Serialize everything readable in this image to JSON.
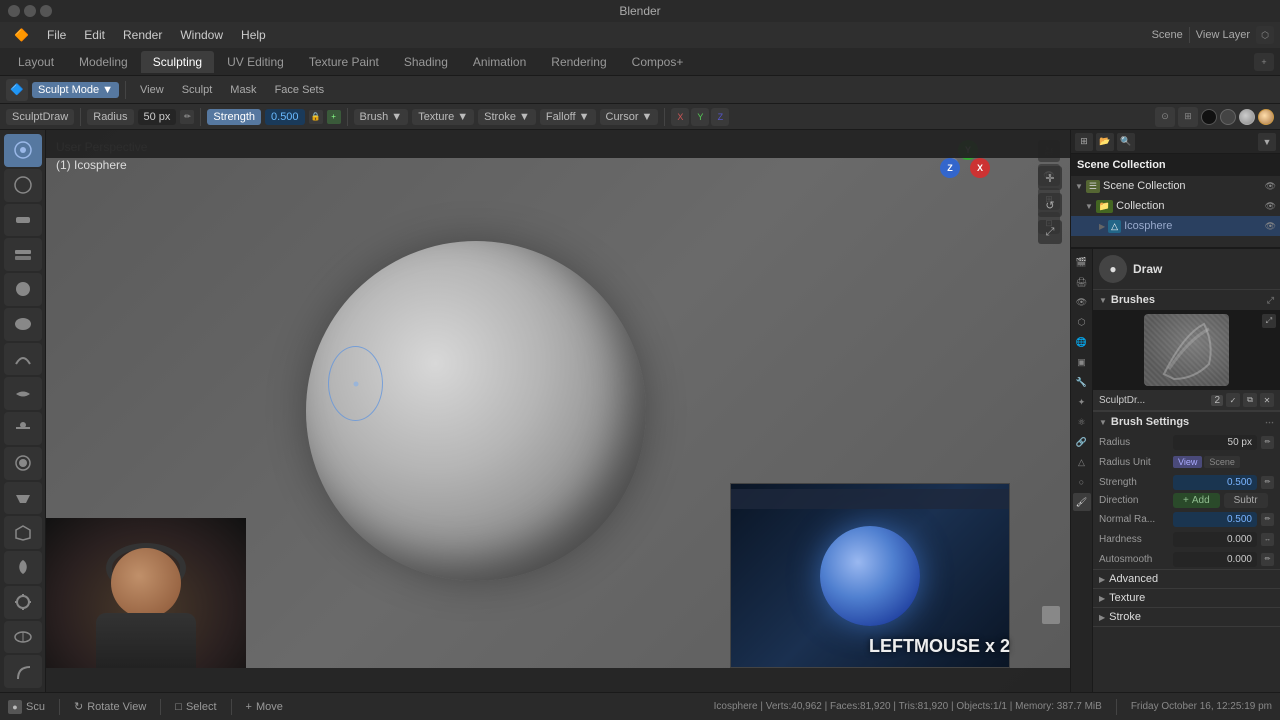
{
  "app": {
    "title": "Blender",
    "version": "Blender"
  },
  "title_bar": {
    "title": "Blender",
    "win_controls": [
      "close",
      "min",
      "max"
    ]
  },
  "menu_bar": {
    "items": [
      "Blender",
      "File",
      "Edit",
      "Render",
      "Window",
      "Help"
    ]
  },
  "workspace_tabs": {
    "items": [
      "Layout",
      "Modeling",
      "Sculpting",
      "UV Editing",
      "Texture Paint",
      "Shading",
      "Animation",
      "Rendering",
      "Compos+"
    ],
    "active": "Sculpting"
  },
  "header_toolbar": {
    "mode": "Sculpt Mode",
    "brush_name": "SculptDraw",
    "radius_label": "Radius",
    "radius_val": "50 px",
    "strength_label": "Strength",
    "strength_val": "0.500",
    "brush_dropdown": "Brush",
    "texture_dropdown": "Texture",
    "stroke_dropdown": "Stroke",
    "falloff_dropdown": "Falloff",
    "cursor_dropdown": "Cursor",
    "xyz": [
      "X",
      "Y",
      "Z"
    ],
    "view_tabs": [
      "View",
      "Sculpt",
      "Mask",
      "Face Sets"
    ]
  },
  "viewport": {
    "view_label": "User Perspective",
    "object_label": "(1) Icosphere",
    "mouse_action": "LEFTMOUSE x 2"
  },
  "outliner": {
    "header": "Scene Collection",
    "items": [
      {
        "name": "Scene Collection",
        "indent": 0,
        "icon": "sc"
      },
      {
        "name": "Collection",
        "indent": 1,
        "icon": "col"
      },
      {
        "name": "Icosphere",
        "indent": 2,
        "icon": "mesh",
        "selected": true
      }
    ]
  },
  "properties": {
    "draw_label": "Draw",
    "brushes_label": "Brushes",
    "brush_settings_label": "Brush Settings",
    "advanced_label": "Advanced",
    "texture_label": "Texture",
    "stroke_label": "Stroke",
    "brush_name": "SculptDr...",
    "brush_num": "2",
    "radius_label": "Radius",
    "radius_val": "50 px",
    "radius_unit_label": "Radius Unit",
    "unit_view": "View",
    "unit_scene": "Scene",
    "strength_label": "Strength",
    "strength_val": "0.500",
    "direction_label": "Direction",
    "dir_add": "Add",
    "dir_sub": "Subtr",
    "normal_ra_label": "Normal Ra...",
    "normal_ra_val": "0.500",
    "hardness_label": "Hardness",
    "hardness_val": "0.000",
    "autosmooth_label": "Autosmooth",
    "autosmooth_val": "0.000"
  },
  "bottom_bar": {
    "left_icon": "●",
    "mode_label": "Scu",
    "rotate_icon": "↻",
    "rotate_label": "Rotate View",
    "select_icon": "□",
    "select_label": "Select",
    "move_icon": "+",
    "move_label": "Move",
    "status": "Icosphere | Verts:40,962 | Faces:81,920 | Tris:81,920 | Objects:1/1 | Memory: 387.7 MiB",
    "datetime": "Friday October 16, 12:25:19 pm"
  },
  "view_layer_label": "View Layer",
  "scene_label": "Scene"
}
